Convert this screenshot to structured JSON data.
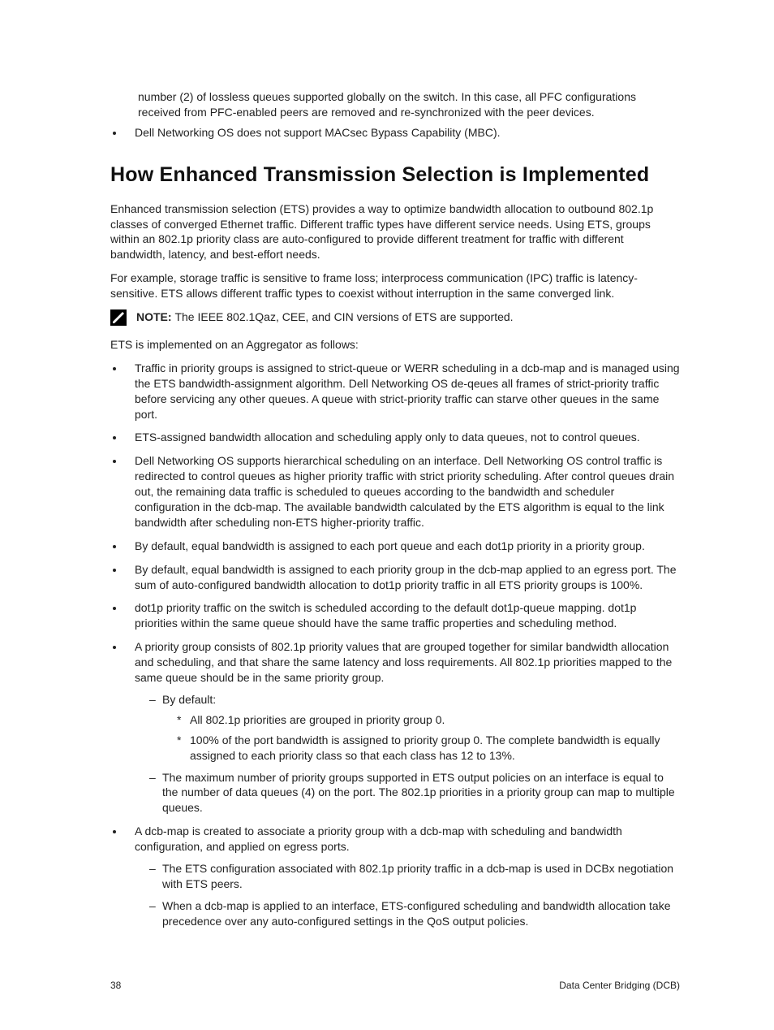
{
  "continuedParagraph": "number (2) of lossless queues supported globally on the switch. In this case, all PFC configurations received from PFC-enabled peers are removed and re-synchronized with the peer devices.",
  "topBullet": "Dell Networking OS does not support MACsec Bypass Capability (MBC).",
  "heading": "How Enhanced Transmission Selection is Implemented",
  "para1": "Enhanced transmission selection (ETS) provides a way to optimize bandwidth allocation to outbound 802.1p classes of converged Ethernet traffic. Different traffic types have different service needs. Using ETS, groups within an 802.1p priority class are auto-configured to provide different treatment for traffic with different bandwidth, latency, and best-effort needs.",
  "para2": "For example, storage traffic is sensitive to frame loss; interprocess communication (IPC) traffic is latency-sensitive. ETS allows different traffic types to coexist without interruption in the same converged link.",
  "noteLabel": "NOTE: ",
  "noteText": "The IEEE 802.1Qaz, CEE, and CIN versions of ETS are supported.",
  "para3": "ETS is implemented on an Aggregator as follows:",
  "etsItems": [
    "Traffic in priority groups is assigned to strict-queue or WERR scheduling in a dcb-map and is managed using the ETS bandwidth-assignment algorithm. Dell Networking OS de-qeues all frames of strict-priority traffic before servicing any other queues. A queue with strict-priority traffic can starve other queues in the same port.",
    "ETS-assigned bandwidth allocation and scheduling apply only to data queues, not to control queues.",
    "Dell Networking OS supports hierarchical scheduling on an interface. Dell Networking OS control traffic is redirected to control queues as higher priority traffic with strict priority scheduling. After control queues drain out, the remaining data traffic is scheduled to queues according to the bandwidth and scheduler configuration in the dcb-map. The available bandwidth calculated by the ETS algorithm is equal to the link bandwidth after scheduling non-ETS higher-priority traffic.",
    "By default, equal bandwidth is assigned to each port queue and each dot1p priority in a priority group.",
    "By default, equal bandwidth is assigned to each priority group in the dcb-map applied to an egress port. The sum of auto-configured bandwidth allocation to dot1p priority traffic in all ETS priority groups is 100%.",
    "dot1p priority traffic on the switch is scheduled according to the default dot1p-queue mapping. dot1p priorities within the same queue should have the same traffic properties and scheduling method.",
    "A priority group consists of 802.1p priority values that are grouped together for similar bandwidth allocation and scheduling, and that share the same latency and loss requirements. All 802.1p priorities mapped to the same queue should be in the same priority group."
  ],
  "pgSub": {
    "byDefault": "By default:",
    "star1": "All 802.1p priorities are grouped in priority group 0.",
    "star2": "100% of the port bandwidth is assigned to priority group 0. The complete bandwidth is equally assigned to each priority class so that each class has 12 to 13%.",
    "maxGroups": "The maximum number of priority groups supported in ETS output policies on an interface is equal to the number of data queues (4) on the port. The 802.1p priorities in a priority group can map to multiple queues."
  },
  "dcbItem": "A dcb-map is created to associate a priority group with a dcb-map with scheduling and bandwidth configuration, and applied on egress ports.",
  "dcbSub1": "The ETS configuration associated with 802.1p priority traffic in a dcb-map is used in DCBx negotiation with ETS peers.",
  "dcbSub2": "When a dcb-map is applied to an interface, ETS-configured scheduling and bandwidth allocation take precedence over any auto-configured settings in the QoS output policies.",
  "pageNumber": "38",
  "footerRight": "Data Center Bridging (DCB)"
}
